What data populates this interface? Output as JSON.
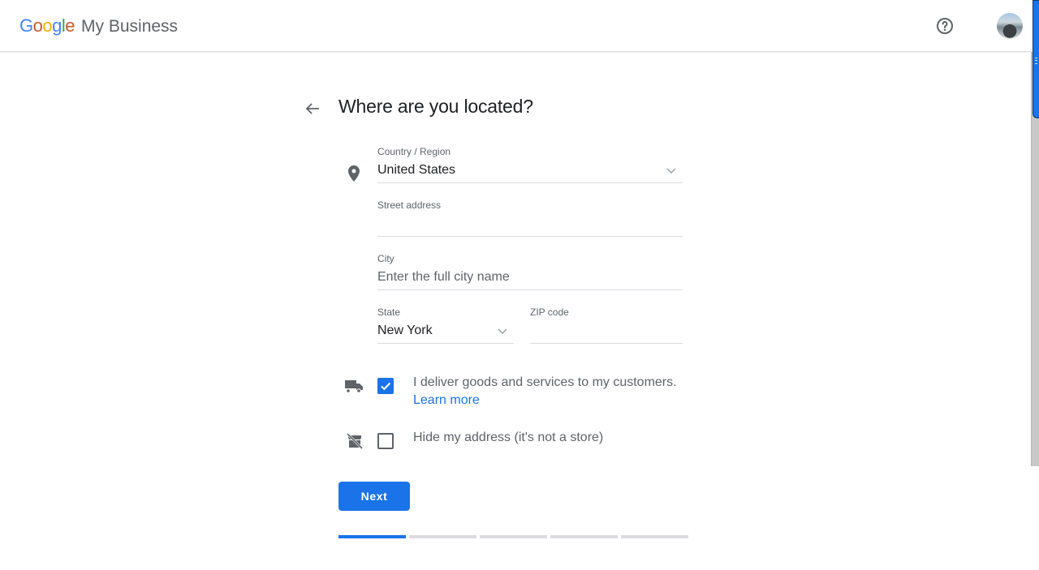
{
  "header": {
    "logo_letters": [
      "G",
      "o",
      "o",
      "g",
      "l",
      "e"
    ],
    "product_name": "My Business",
    "help_icon": "help-circle-icon",
    "avatar": "user-avatar"
  },
  "page": {
    "title": "Where are you located?",
    "back_icon": "arrow-back-icon"
  },
  "form": {
    "country": {
      "label": "Country / Region",
      "value": "United States",
      "icon": "place-icon"
    },
    "street": {
      "label": "Street address",
      "value": "",
      "placeholder": ""
    },
    "city": {
      "label": "City",
      "value": "",
      "placeholder": "Enter the full city name"
    },
    "state": {
      "label": "State",
      "value": "New York"
    },
    "zip": {
      "label": "ZIP code",
      "value": "",
      "placeholder": ""
    },
    "delivery": {
      "label": "I deliver goods and services to my customers.",
      "link": "Learn more",
      "checked": true,
      "icon": "truck-icon"
    },
    "hide_address": {
      "label": "Hide my address (it's not a store)",
      "checked": false,
      "icon": "store-off-icon"
    }
  },
  "actions": {
    "next_label": "Next"
  },
  "progress": {
    "total_steps": 5,
    "current_step": 1
  },
  "colors": {
    "accent": "#1a73e8",
    "muted": "#5f6368",
    "divider": "#dadce0"
  }
}
